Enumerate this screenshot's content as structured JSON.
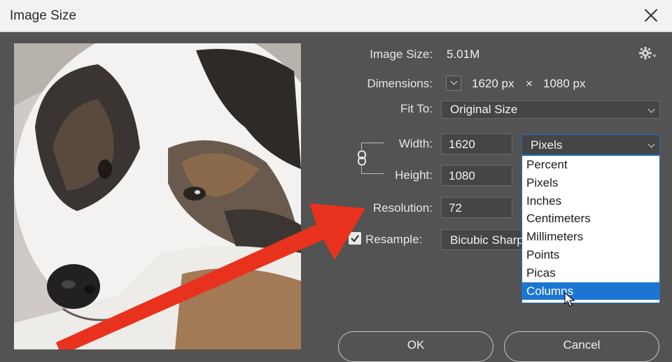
{
  "window": {
    "title": "Image Size"
  },
  "info": {
    "image_size_label": "Image Size:",
    "image_size_value": "5.01M",
    "dimensions_label": "Dimensions:",
    "dim_width": "1620 px",
    "dim_sep": "×",
    "dim_height": "1080 px",
    "fit_to_label": "Fit To:",
    "fit_to_value": "Original Size"
  },
  "fields": {
    "width_label": "Width:",
    "width_value": "1620",
    "width_unit": "Pixels",
    "height_label": "Height:",
    "height_value": "1080",
    "resolution_label": "Resolution:",
    "resolution_value": "72",
    "resample_label": "Resample:",
    "resample_value": "Bicubic Sharp",
    "resample_checked": true
  },
  "unit_dropdown": {
    "options": [
      "Percent",
      "Pixels",
      "Inches",
      "Centimeters",
      "Millimeters",
      "Points",
      "Picas",
      "Columns"
    ],
    "highlighted": "Columns"
  },
  "buttons": {
    "ok": "OK",
    "cancel": "Cancel"
  },
  "colors": {
    "dialog_bg": "#535353",
    "highlight": "#1b76d1",
    "annotation_arrow": "#e8321e"
  },
  "icons": {
    "gear": "gear-icon",
    "link": "link-chain-icon",
    "close": "close-icon"
  }
}
